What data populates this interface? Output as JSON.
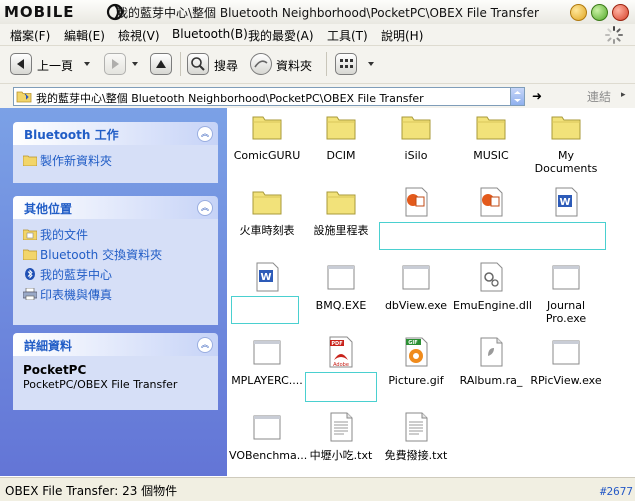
{
  "window": {
    "logo": "MOBILE",
    "title": "我的藍芽中心\\整個 Bluetooth Neighborhood\\PocketPC\\OBEX File Transfer"
  },
  "menu": [
    "檔案(F)",
    "編輯(E)",
    "檢視(V)",
    "Bluetooth(B)",
    "我的最愛(A)",
    "工具(T)",
    "說明(H)"
  ],
  "toolbar": {
    "back_label": "上一頁",
    "search_label": "搜尋",
    "folders_label": "資料夾"
  },
  "address": {
    "path": "我的藍芽中心\\整個 Bluetooth Neighborhood\\PocketPC\\OBEX File Transfer",
    "go_glyph": "➜",
    "link_label": "連結",
    "chevron": "▸"
  },
  "panels": {
    "bt_tasks": {
      "title": "Bluetooth 工作",
      "collapse": "︽",
      "items": [
        {
          "label": "製作新資料夾"
        }
      ]
    },
    "other_places": {
      "title": "其他位置",
      "collapse": "︽",
      "items": [
        {
          "label": "我的文件"
        },
        {
          "label": "Bluetooth 交換資料夾"
        },
        {
          "label": "我的藍芽中心"
        },
        {
          "label": "印表機與傳真"
        }
      ]
    },
    "details": {
      "title": "詳細資料",
      "collapse": "︽",
      "name": "PocketPC",
      "path": "PocketPC/OBEX File Transfer"
    }
  },
  "files": [
    {
      "name": "ComicGURU",
      "icon": "folder-icon"
    },
    {
      "name": "DCIM",
      "icon": "folder-icon"
    },
    {
      "name": "iSilo",
      "icon": "folder-icon"
    },
    {
      "name": "MUSIC",
      "icon": "folder-icon"
    },
    {
      "name": "My Documents",
      "icon": "folder-icon"
    },
    {
      "name": "火車時刻表",
      "icon": "folder-icon"
    },
    {
      "name": "設施里程表",
      "icon": "folder-icon"
    },
    {
      "name": "",
      "icon": "powerpoint-file-icon"
    },
    {
      "name": "",
      "icon": "powerpoint-file-icon"
    },
    {
      "name": "",
      "icon": "word-file-icon"
    },
    {
      "name": "",
      "icon": "word-file-icon"
    },
    {
      "name": "BMQ.EXE",
      "icon": "exe-file-icon"
    },
    {
      "name": "dbView.exe",
      "icon": "exe-file-icon"
    },
    {
      "name": "EmuEngine.dll",
      "icon": "dll-file-icon"
    },
    {
      "name": "Journal Pro.exe",
      "icon": "exe-file-icon"
    },
    {
      "name": "MPLAYERC....",
      "icon": "exe-file-icon"
    },
    {
      "name": "",
      "icon": "pdf-file-icon"
    },
    {
      "name": "Picture.gif",
      "icon": "gif-file-icon"
    },
    {
      "name": "RAlbum.ra_",
      "icon": "generic-file-icon"
    },
    {
      "name": "RPicView.exe",
      "icon": "exe-file-icon"
    },
    {
      "name": "VOBenchma...",
      "icon": "exe-file-icon"
    },
    {
      "name": "中壢小吃.txt",
      "icon": "text-file-icon"
    },
    {
      "name": "免費撥接.txt",
      "icon": "text-file-icon"
    }
  ],
  "icon_labels": {
    "pdf": "PDF",
    "adobe": "Adobe",
    "gif": "GIF",
    "word": "W"
  },
  "status": {
    "text": "OBEX File Transfer: 23 個物件",
    "counter": "#2677"
  },
  "colors": {
    "panel_blue": "#215dc6",
    "taskpane_top": "#7ba1e6",
    "taskpane_bottom": "#6375d6",
    "folder": "#f2e27a",
    "selection": "#4ad0d0"
  }
}
